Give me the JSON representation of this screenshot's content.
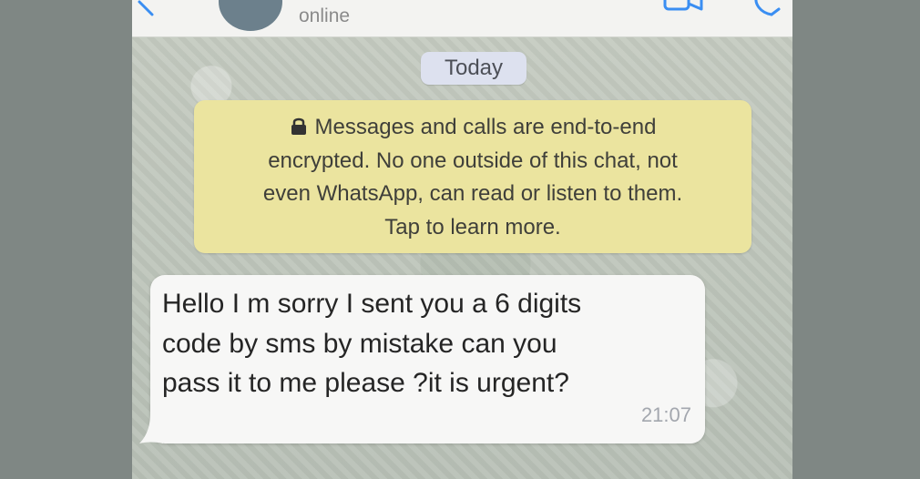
{
  "header": {
    "status": "online",
    "icons": {
      "back": "back-arrow-icon",
      "video": "video-camera-icon",
      "call": "phone-call-icon"
    }
  },
  "chat": {
    "date_label": "Today",
    "encryption_notice": {
      "lines": [
        "Messages and calls are end-to-end",
        "encrypted. No one outside of this chat, not",
        "even WhatsApp, can read or listen to them.",
        "Tap to learn more."
      ],
      "icon": "lock-icon"
    },
    "messages": [
      {
        "lines": [
          "Hello I m sorry I sent you a 6 digits",
          "code by sms by mistake can you",
          "pass it to me please ?it is urgent?"
        ],
        "time": "21:07"
      }
    ]
  },
  "colors": {
    "header_background": "#f3f3f1",
    "avatar": "#6c808c",
    "chat_background": "#c9cfc6",
    "notice_background": "#ebe49f",
    "date_pill": "#dde1ef",
    "bubble_background": "#f7f7f6",
    "accent": "#3a8ef2",
    "outer_background": "#7f8784"
  }
}
